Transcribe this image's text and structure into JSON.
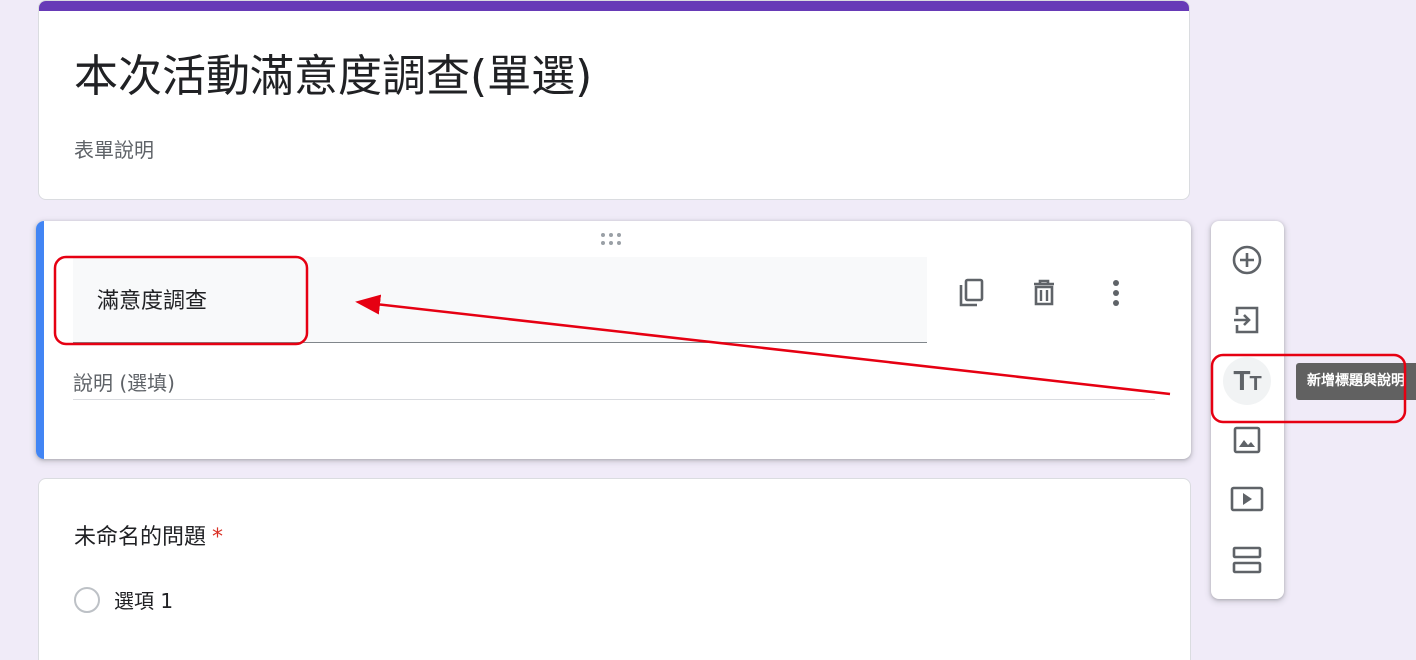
{
  "form": {
    "title": "本次活動滿意度調查(單選)",
    "description": "表單說明"
  },
  "section": {
    "title": "滿意度調查",
    "description_placeholder": "說明 (選填)",
    "actions": {
      "duplicate_icon": "duplicate-icon",
      "delete_icon": "trash-icon",
      "more_icon": "more-vert-icon"
    }
  },
  "question": {
    "title": "未命名的問題",
    "required_marker": "*",
    "options": [
      "選項 1"
    ]
  },
  "toolbar": {
    "items": [
      {
        "icon": "add-circle-icon"
      },
      {
        "icon": "import-questions-icon"
      },
      {
        "icon": "title-text-icon",
        "glyph_big": "T",
        "glyph_small": "T"
      },
      {
        "icon": "image-icon"
      },
      {
        "icon": "video-icon"
      },
      {
        "icon": "add-section-icon"
      }
    ],
    "tooltip": "新增標題與說明"
  },
  "colors": {
    "background": "#f0ebf8",
    "header_accent": "#673ab7",
    "active_bar": "#4285f4",
    "required": "#d93025",
    "annotation": "#e60012"
  }
}
